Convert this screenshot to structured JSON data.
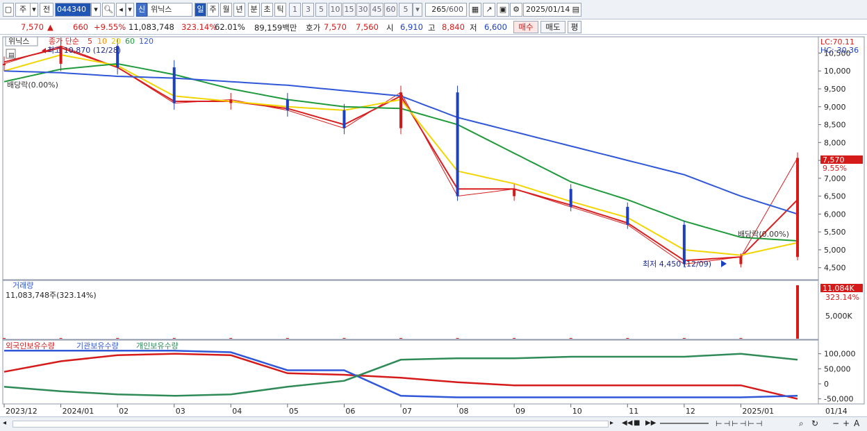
{
  "toolbar": {
    "kind": "주",
    "prev": "전",
    "code": "044340",
    "badge": "신",
    "name": "위닉스",
    "periods": [
      "일",
      "주",
      "월",
      "년",
      "분",
      "초",
      "틱"
    ],
    "intervals": [
      "1",
      "3",
      "5",
      "10",
      "15",
      "30",
      "45",
      "60"
    ],
    "interval_value": "5",
    "count": "265",
    "count_max": "/600",
    "date": "2025/01/14"
  },
  "quote": {
    "price": "7,570",
    "change": "660",
    "rate": "+9.55%",
    "volume": "11,083,748",
    "volume_rate": "323.14%",
    "turnover": "62.01%",
    "amount": "89,159백만",
    "hoga_label": "호가",
    "ask": "7,570",
    "bid": "7,560",
    "open_label": "시",
    "open": "6,910",
    "high_label": "고",
    "high": "8,840",
    "low_label": "저",
    "low": "6,600",
    "buy": "매수",
    "sell": "매도",
    "eval": "평"
  },
  "price_panel": {
    "name_tag": "위닉스",
    "legend_prefix": "종가 단순",
    "ma": [
      {
        "period": "5",
        "color": "#d81e1e"
      },
      {
        "period": "10",
        "color": "#ff8c00"
      },
      {
        "period": "20",
        "color": "#f2d500"
      },
      {
        "period": "60",
        "color": "#1f9a3a"
      },
      {
        "period": "120",
        "color": "#2f57d8"
      }
    ],
    "high_note": "최고 10,870 (12/28)",
    "low_note": "최저 4,450 (12/09)",
    "dividend_1": "배당락(0.00%)",
    "dividend_2": "배당락(0.00%)",
    "lc": "LC:70.11",
    "hc": "HC:-30.36",
    "current_price": "7,570",
    "current_rate": "9.55%",
    "y_ticks": [
      "10,500",
      "10,000",
      "9,500",
      "9,000",
      "8,500",
      "8,000",
      "7,500",
      "7,000",
      "6,500",
      "6,000",
      "5,500",
      "5,000",
      "4,500"
    ]
  },
  "volume_panel": {
    "title": "거래량",
    "value": "11,083,748주(323.14%)",
    "current": "11,084K",
    "current_rate": "323.14%",
    "y_tick": "5,000K"
  },
  "holdings_panel": {
    "legends": [
      "외국인보유수량",
      "기관보유수량",
      "개인보유수량"
    ],
    "colors": [
      "#d51a1a",
      "#2f57d8",
      "#2e8b57"
    ],
    "y_ticks": [
      "100,000",
      "50,000",
      "0",
      "-50,000"
    ]
  },
  "x_axis": [
    "2023/12",
    "2024/01",
    "02",
    "03",
    "04",
    "05",
    "06",
    "07",
    "08",
    "09",
    "10",
    "11",
    "12",
    "2025/01",
    "01/14"
  ],
  "chart_data": {
    "type": "line",
    "title": "",
    "x": [
      "2023/12",
      "2024/01",
      "02",
      "03",
      "04",
      "05",
      "06",
      "07",
      "08",
      "09",
      "10",
      "11",
      "12",
      "2025/01",
      "01/14"
    ],
    "ylabel": "",
    "ylim": [
      4300,
      10800
    ],
    "series": [
      {
        "name": "종가",
        "values": [
          10200,
          10700,
          10100,
          9100,
          9200,
          8900,
          8400,
          9400,
          6500,
          6700,
          6200,
          5700,
          4600,
          4800,
          7570
        ]
      },
      {
        "name": "5",
        "values": [
          10250,
          10650,
          10100,
          9150,
          9150,
          8950,
          8500,
          9300,
          6700,
          6700,
          6250,
          5750,
          4700,
          4800,
          6400
        ]
      },
      {
        "name": "20",
        "values": [
          10000,
          10450,
          10150,
          9300,
          9150,
          9000,
          8900,
          9200,
          7200,
          6850,
          6350,
          5900,
          5000,
          4850,
          5200
        ]
      },
      {
        "name": "60",
        "values": [
          9700,
          10050,
          10200,
          9900,
          9500,
          9200,
          9000,
          8950,
          8500,
          7700,
          6900,
          6400,
          5800,
          5350,
          5250
        ]
      },
      {
        "name": "120",
        "values": [
          10000,
          9950,
          9850,
          9800,
          9700,
          9600,
          9450,
          9300,
          8700,
          8300,
          7900,
          7500,
          7100,
          6500,
          6000
        ]
      }
    ],
    "volume": {
      "values": [
        0.3,
        0.2,
        0.1,
        0.1,
        0.2,
        0.1,
        0.15,
        0.3,
        0.15,
        0.1,
        0.1,
        0.1,
        0.1,
        0.5,
        11084
      ],
      "unit": "K"
    },
    "holdings": [
      {
        "name": "외국인보유수량",
        "values": [
          40000,
          75000,
          95000,
          100000,
          95000,
          35000,
          30000,
          20000,
          5000,
          -5000,
          -5000,
          -5000,
          -5000,
          -5000,
          -50000
        ]
      },
      {
        "name": "기관보유수량",
        "values": [
          110000,
          110000,
          110000,
          110000,
          105000,
          45000,
          45000,
          -40000,
          -45000,
          -45000,
          -45000,
          -45000,
          -45000,
          -45000,
          -40000
        ]
      },
      {
        "name": "개인보유수량",
        "values": [
          -10000,
          -25000,
          -35000,
          -40000,
          -35000,
          -10000,
          10000,
          80000,
          85000,
          85000,
          90000,
          90000,
          90000,
          100000,
          80000
        ]
      }
    ]
  }
}
